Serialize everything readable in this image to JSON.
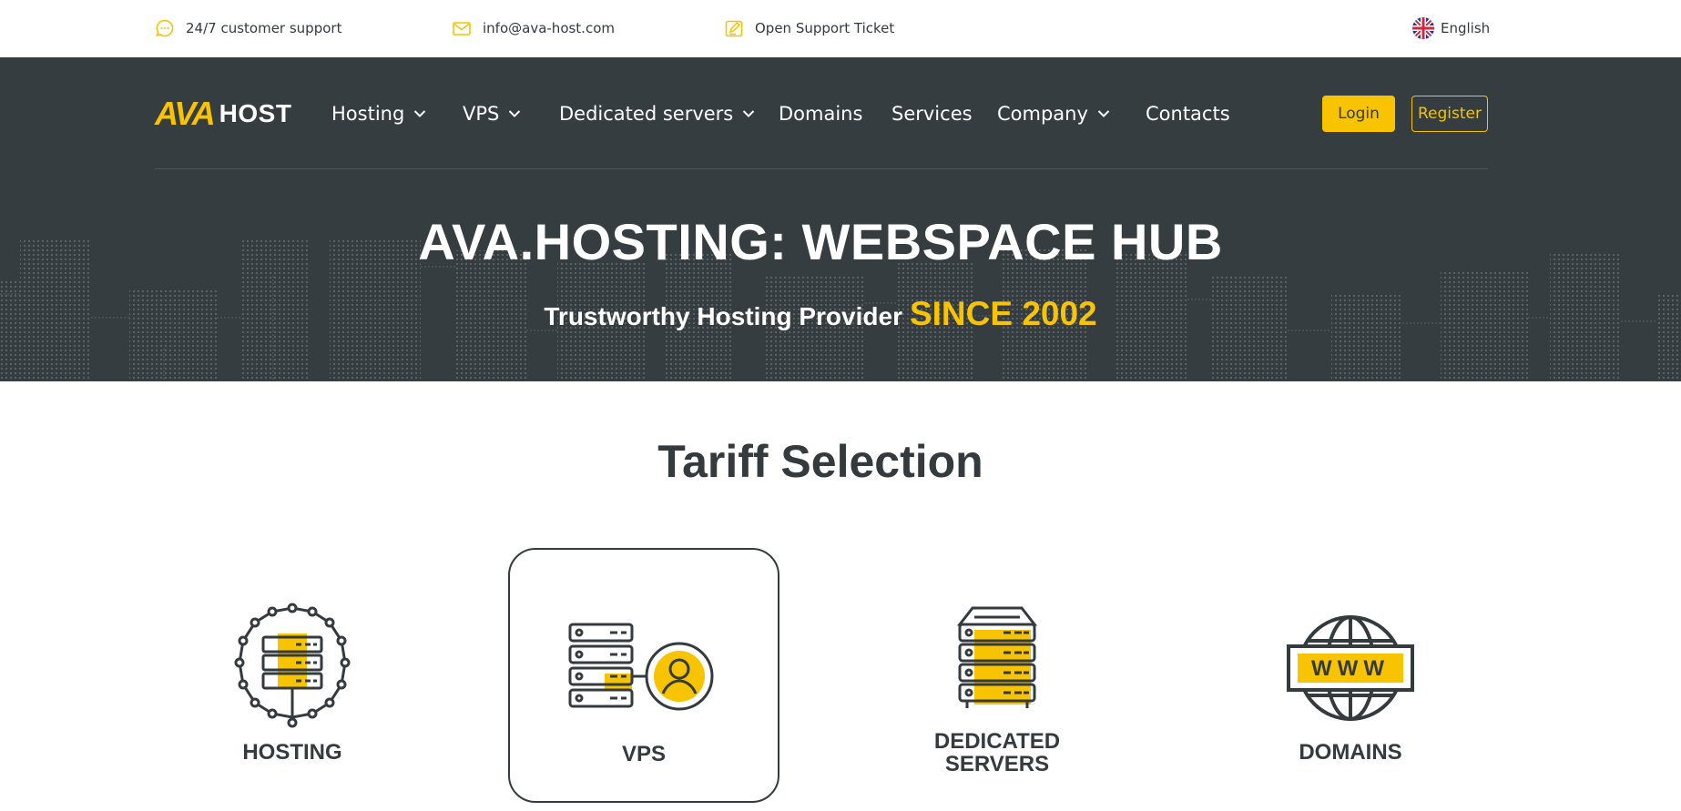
{
  "topbar": {
    "support_text": "24/7 customer support",
    "email_text": "info@ava-host.com",
    "ticket_text": "Open Support Ticket",
    "language": "English"
  },
  "header": {
    "logo_ava": "AVA",
    "logo_host": "HOST",
    "nav": [
      {
        "label": "Hosting",
        "dropdown": true
      },
      {
        "label": "VPS",
        "dropdown": true
      },
      {
        "label": "Dedicated servers",
        "dropdown": true
      },
      {
        "label": "Domains",
        "dropdown": false
      },
      {
        "label": "Services",
        "dropdown": false
      },
      {
        "label": "Company",
        "dropdown": true
      },
      {
        "label": "Contacts",
        "dropdown": false
      }
    ],
    "login_label": "Login",
    "register_label": "Register"
  },
  "hero": {
    "title": "AVA.HOSTING: WEBSPACE HUB",
    "subtitle_lead": "Trustworthy Hosting Provider",
    "subtitle_highlight": "SINCE 2002"
  },
  "tariffs": {
    "title": "Tariff Selection",
    "cards": [
      {
        "label": "HOSTING",
        "icon": "hosting-network-icon",
        "active": false
      },
      {
        "label": "VPS",
        "icon": "vps-server-user-icon",
        "active": true
      },
      {
        "label_line1": "DEDICATED",
        "label_line2": "SERVERS",
        "icon": "dedicated-server-rack-icon",
        "active": false
      },
      {
        "label": "DOMAINS",
        "icon": "globe-www-icon",
        "active": false,
        "icon_text": "WWW"
      }
    ]
  },
  "colors": {
    "accent": "#f8c300",
    "dark": "#363d41",
    "text": "#343b3f",
    "white": "#ffffff"
  }
}
